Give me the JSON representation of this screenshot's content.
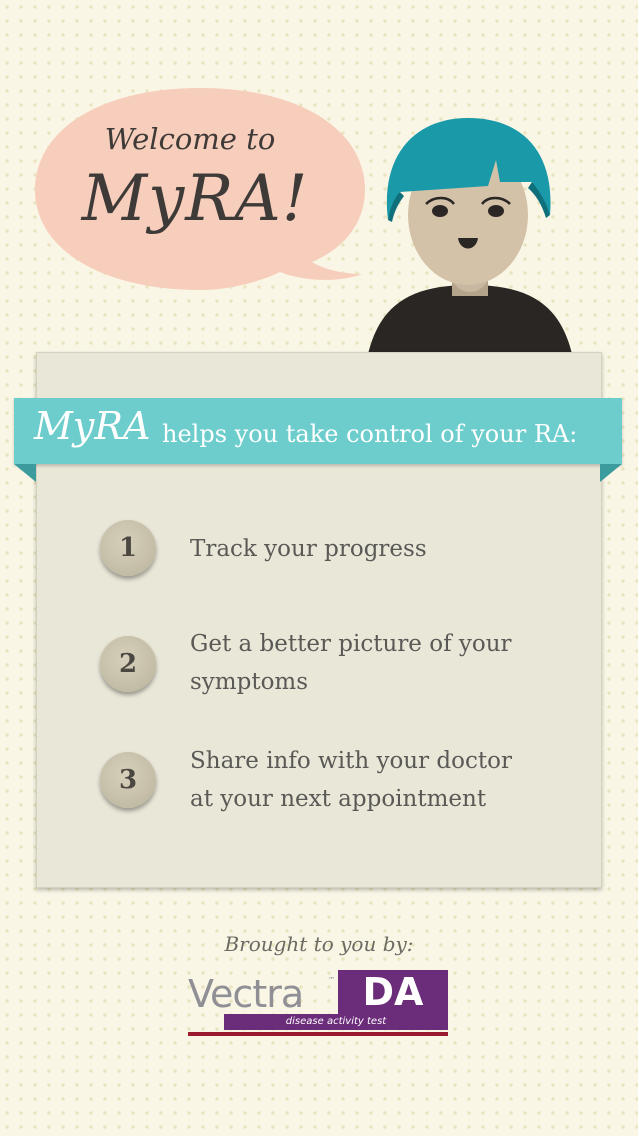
{
  "header": {
    "welcome_line": "Welcome to",
    "app_name": "MyRA!"
  },
  "ribbon": {
    "logo": "MyRA",
    "text": "helps you take control of your RA:"
  },
  "steps": [
    {
      "number": "1",
      "line1": "Track your progress",
      "line2": ""
    },
    {
      "number": "2",
      "line1": "Get a better picture of your",
      "line2": "symptoms"
    },
    {
      "number": "3",
      "line1": "Share info with your doctor",
      "line2": "at your next appointment"
    }
  ],
  "footer": {
    "credit": "Brought to you by:",
    "logo": {
      "word": "Vectra",
      "tm": "™",
      "badge": "DA",
      "tagline": "disease activity test"
    }
  },
  "colors": {
    "background": "#f9f6e6",
    "bubble": "#f7cdbb",
    "ribbon": "#6dcdcc",
    "panel": "#e9e7d8",
    "hair": "#1a9aa8",
    "brand_purple": "#6b2c7a",
    "brand_red": "#9a1a2e"
  }
}
